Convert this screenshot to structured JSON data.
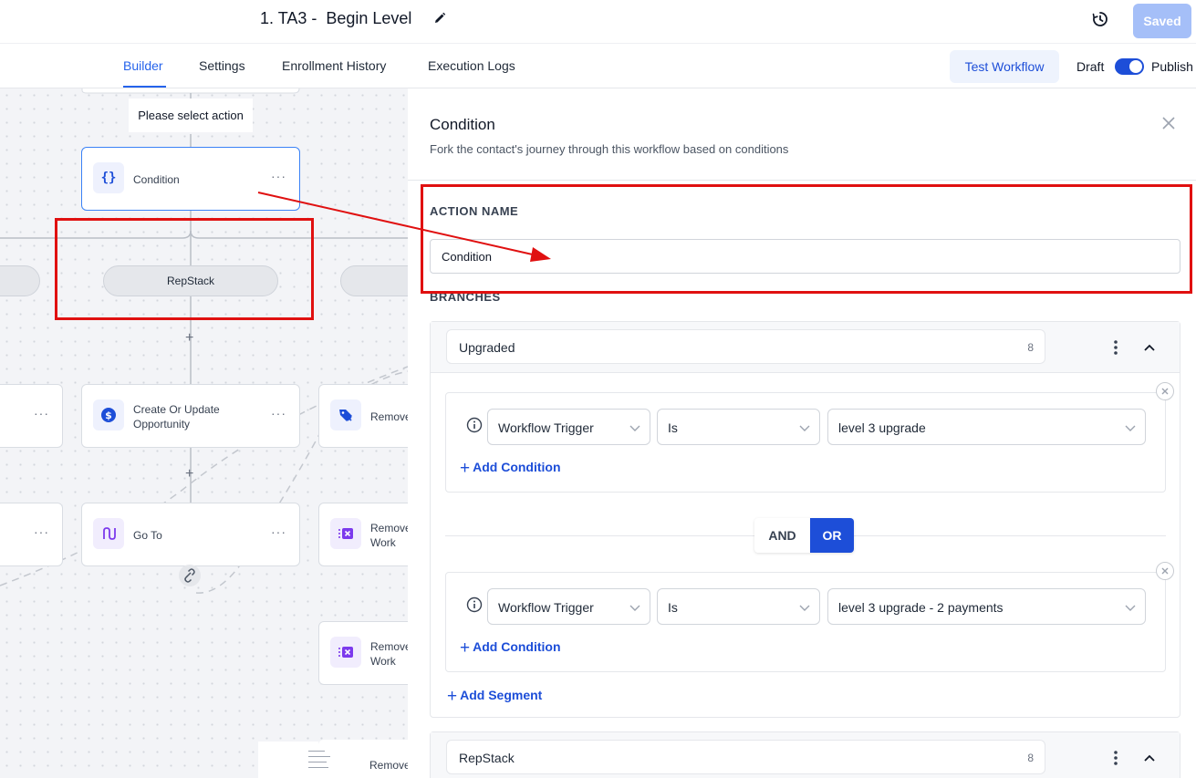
{
  "header": {
    "title": "1. TA3 -  Begin Level",
    "saved_label": "Saved"
  },
  "nav": {
    "tabs": [
      {
        "label": "Builder",
        "active": true
      },
      {
        "label": "Settings",
        "active": false
      },
      {
        "label": "Enrollment History",
        "active": false
      },
      {
        "label": "Execution Logs",
        "active": false
      }
    ],
    "test_workflow_label": "Test Workflow",
    "draft_label": "Draft",
    "publish_label": "Publish",
    "publish_toggle_on": true
  },
  "canvas": {
    "tooltip": "Please select action",
    "nodes": {
      "condition": "Condition",
      "create_opportunity": "Create Or Update Opportunity",
      "remove_1": "Remove",
      "goto": "Go To",
      "remove_2": "Remove in Work",
      "remove_3": "Remove in Work",
      "remove_4": "Remove"
    },
    "branch_pill": "RepStack",
    "kebab": "···"
  },
  "panel": {
    "title": "Condition",
    "subtitle": "Fork the contact's journey through this workflow based on conditions",
    "action_name_label": "ACTION NAME",
    "action_name_value": "Condition",
    "branches_label": "BRANCHES",
    "branches": [
      {
        "name": "Upgraded",
        "count": "8",
        "segments": [
          {
            "field": "Workflow Trigger",
            "operator": "Is",
            "value": "level 3 upgrade",
            "add_condition": "Add Condition"
          },
          {
            "field": "Workflow Trigger",
            "operator": "Is",
            "value": "level 3 upgrade - 2 payments",
            "add_condition": "Add Condition"
          }
        ],
        "and_label": "AND",
        "or_label": "OR",
        "add_segment": "Add Segment"
      },
      {
        "name": "RepStack",
        "count": "8"
      }
    ]
  },
  "colors": {
    "accent": "#1d4ed8",
    "highlight_red": "#e01010",
    "saved_button": "#a5bff8"
  }
}
